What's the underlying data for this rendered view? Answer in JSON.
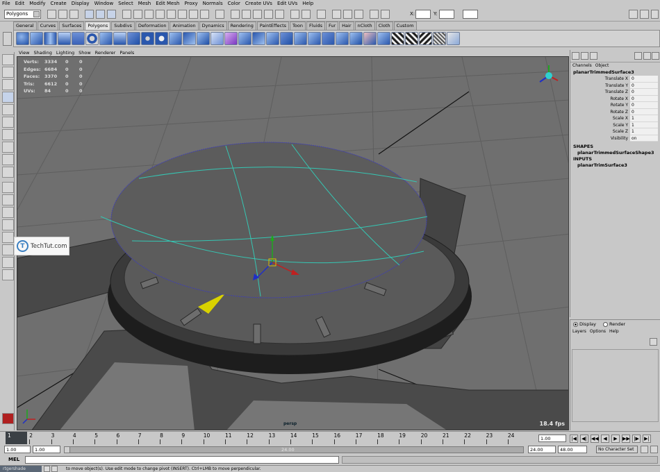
{
  "menubar": {
    "items": [
      "File",
      "Edit",
      "Modify",
      "Create",
      "Display",
      "Window",
      "Select",
      "Mesh",
      "Edit Mesh",
      "Proxy",
      "Normals",
      "Color",
      "Create UVs",
      "Edit UVs",
      "Help"
    ]
  },
  "statusline": {
    "mode": "Polygons",
    "x_label": "X:",
    "y_label": "Y:"
  },
  "shelf": {
    "tabs": [
      "General",
      "Curves",
      "Surfaces",
      "Polygons",
      "Subdivs",
      "Deformation",
      "Animation",
      "Dynamics",
      "Rendering",
      "PaintEffects",
      "Toon",
      "Fluids",
      "Fur",
      "Hair",
      "nCloth",
      "Cloth",
      "Custom"
    ],
    "active_tab": "Polygons"
  },
  "panel_menu": [
    "View",
    "Shading",
    "Lighting",
    "Show",
    "Renderer",
    "Panels"
  ],
  "hud": {
    "rows": [
      {
        "label": "Verts:",
        "value": "3334",
        "sel": "0",
        "extra": "0"
      },
      {
        "label": "Edges:",
        "value": "6684",
        "sel": "0",
        "extra": "0"
      },
      {
        "label": "Faces:",
        "value": "3370",
        "sel": "0",
        "extra": "0"
      },
      {
        "label": "Tris:",
        "value": "6612",
        "sel": "0",
        "extra": "0"
      },
      {
        "label": "UVs:",
        "value": "84",
        "sel": "0",
        "extra": "0"
      }
    ]
  },
  "viewport": {
    "fps": "18.4 fps",
    "camera": "persp"
  },
  "watermark": {
    "text": "TechTut.com",
    "initial": "T"
  },
  "channel_box": {
    "menu": [
      "Channels",
      "Object"
    ],
    "node": "planarTrimmedSurface3",
    "attributes": [
      {
        "name": "Translate X",
        "value": "0"
      },
      {
        "name": "Translate Y",
        "value": "0"
      },
      {
        "name": "Translate Z",
        "value": "0"
      },
      {
        "name": "Rotate X",
        "value": "0"
      },
      {
        "name": "Rotate Y",
        "value": "0"
      },
      {
        "name": "Rotate Z",
        "value": "0"
      },
      {
        "name": "Scale X",
        "value": "1"
      },
      {
        "name": "Scale Y",
        "value": "1"
      },
      {
        "name": "Scale Z",
        "value": "1"
      },
      {
        "name": "Visibility",
        "value": "on"
      }
    ],
    "shapes_header": "SHAPES",
    "shape_node": "planarTrimmedSurfaceShape3",
    "inputs_header": "INPUTS",
    "input_node": "planarTrimSurface3"
  },
  "layer_editor": {
    "display_label": "Display",
    "render_label": "Render",
    "menu": [
      "Layers",
      "Options",
      "Help"
    ]
  },
  "time_slider": {
    "ticks": [
      "1",
      "2",
      "3",
      "4",
      "5",
      "6",
      "7",
      "8",
      "9",
      "10",
      "11",
      "12",
      "13",
      "14",
      "15",
      "16",
      "17",
      "18",
      "19",
      "20",
      "21",
      "22",
      "23",
      "24"
    ],
    "current_frame": "1.00"
  },
  "range_slider": {
    "start": "1.00",
    "inner_start": "1.00",
    "bar_label": "24.00",
    "end": "24.00",
    "outer_end": "48.00",
    "character_set": "No Character Set"
  },
  "command_line": {
    "label": "MEL"
  },
  "help_line": {
    "text": "to move object(s). Use edit mode to change pivot (INSERT). Ctrl+LMB to move perpendicular.",
    "taskbar": "rtgershade"
  },
  "colors": {
    "viewport_bg": "#6f6f6f",
    "grid": "#5c5c5c",
    "watch_face": "#5c5c5c",
    "seam": "#35c7b4",
    "accent_yellow": "#d9d200"
  }
}
